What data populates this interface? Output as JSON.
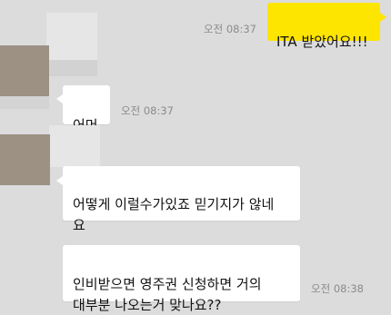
{
  "theme": {
    "background": "#dcdcdc",
    "incoming_bubble": "#ffffff",
    "outgoing_bubble": "#fee500",
    "avatar_color": "#9c9183",
    "time_color": "#8b8b8b"
  },
  "messages": [
    {
      "direction": "outgoing",
      "text": "ITA 받았어요!!!",
      "time": "오전 08:37"
    },
    {
      "direction": "incoming",
      "text": "어머",
      "time": "오전 08:37"
    },
    {
      "direction": "incoming",
      "text": "어떻게 이럴수가있죠 믿기지가 않네\n요",
      "time": ""
    },
    {
      "direction": "incoming",
      "text": "인비받으면 영주권 신청하면 거의\n대부분 나오는거 맞나요??",
      "time": "오전 08:38"
    }
  ]
}
